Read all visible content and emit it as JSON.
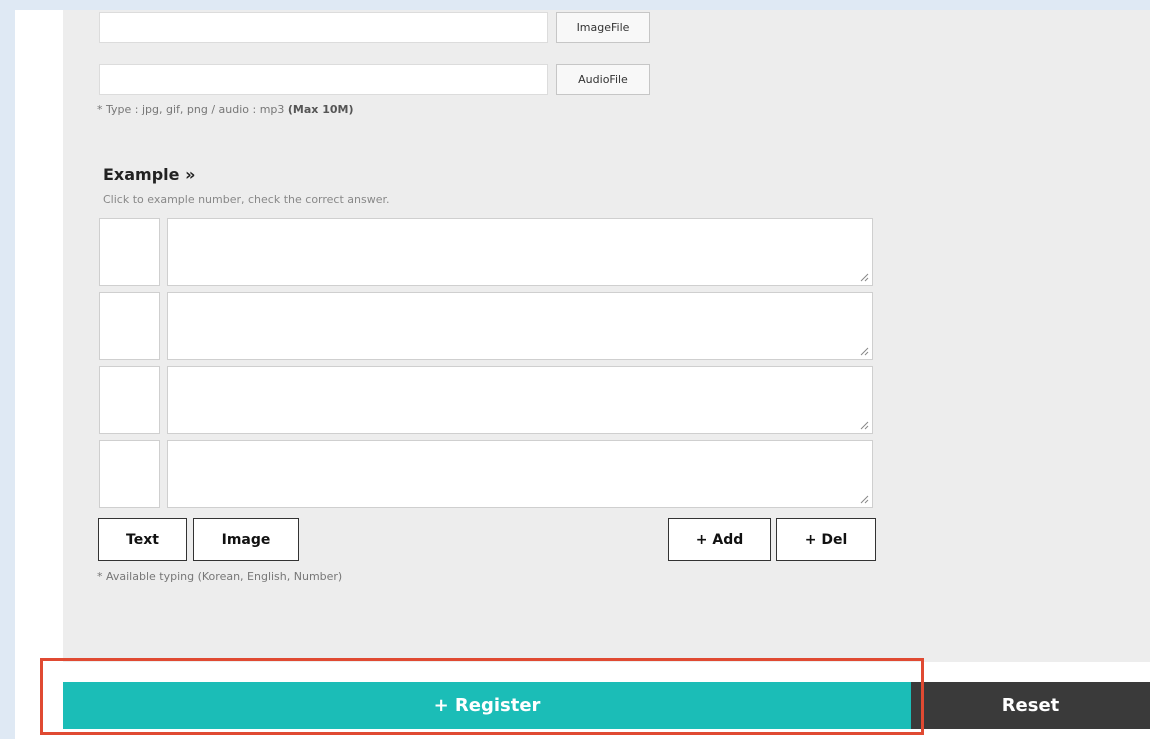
{
  "files": {
    "image_button": "ImageFile",
    "audio_button": "AudioFile",
    "image_value": "",
    "audio_value": "",
    "type_note_prefix": "* Type : jpg, gif, png / audio : mp3",
    "type_note_bold": "(Max 10M)"
  },
  "example": {
    "title": "Example »",
    "subtitle": "Click to example number, check the correct answer.",
    "rows": [
      {
        "number": "",
        "answer": ""
      },
      {
        "number": "",
        "answer": ""
      },
      {
        "number": "",
        "answer": ""
      },
      {
        "number": "",
        "answer": ""
      }
    ]
  },
  "toolbar": {
    "text_label": "Text",
    "image_label": "Image",
    "add_label": "+ Add",
    "del_label": "+ Del"
  },
  "typing_note": "* Available typing (Korean, English, Number)",
  "actions": {
    "register_label": "+ Register",
    "reset_label": "Reset"
  },
  "colors": {
    "register": "#1bbdb7",
    "reset": "#3a3a3a",
    "highlight": "#e04a32",
    "panel": "#ededed"
  }
}
